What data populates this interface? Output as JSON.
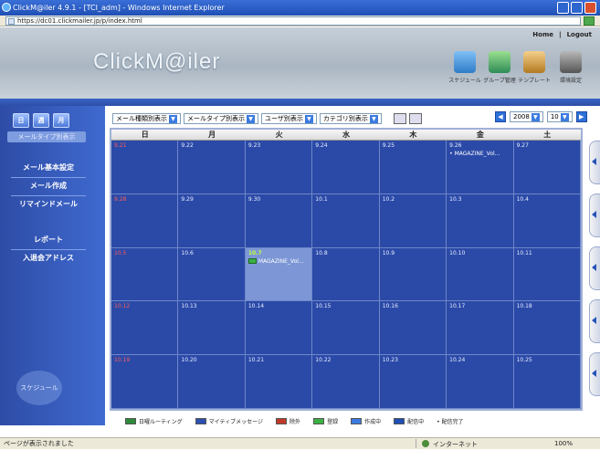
{
  "window": {
    "title": "ClickM@iler 4.9.1 - [TCI_adm] - Windows Internet Explorer"
  },
  "address": {
    "url": "https://dc01.clickmailer.jp/p/index.html"
  },
  "header": {
    "logo": "ClickM@iler",
    "links": {
      "home": "Home",
      "sep": "|",
      "logout": "Logout"
    },
    "icons": [
      {
        "label": "スケジュール",
        "icon": "schedule-icon",
        "color": "#3a8fd8"
      },
      {
        "label": "グループ管理",
        "icon": "group-icon",
        "color": "#2e8b57"
      },
      {
        "label": "テンプレート",
        "icon": "template-icon",
        "color": "#c58a2c"
      },
      {
        "label": "環境設定",
        "icon": "settings-icon",
        "color": "#555555"
      }
    ]
  },
  "sidebar": {
    "active_tab": "メールタイプ別表示",
    "items": [
      "メール基本設定",
      "メール作成",
      "リマインドメール",
      "レポート",
      "入退会アドレス"
    ],
    "schedule_label": "スケジュール"
  },
  "toolbar": {
    "filters": [
      "メール種類別表示",
      "メールタイプ別表示",
      "ユーザ別表示",
      "カテゴリ別表示"
    ],
    "year": "2008",
    "month": "10"
  },
  "calendar": {
    "weekdays": [
      "日",
      "月",
      "火",
      "水",
      "木",
      "金",
      "土"
    ],
    "weeks": [
      [
        {
          "d": "9.21"
        },
        {
          "d": "9.22"
        },
        {
          "d": "9.23"
        },
        {
          "d": "9.24"
        },
        {
          "d": "9.25"
        },
        {
          "d": "9.26",
          "event": "• MAGAZINE_Vol..."
        },
        {
          "d": "9.27"
        }
      ],
      [
        {
          "d": "9.28"
        },
        {
          "d": "9.29"
        },
        {
          "d": "9.30"
        },
        {
          "d": "10.1"
        },
        {
          "d": "10.2"
        },
        {
          "d": "10.3"
        },
        {
          "d": "10.4"
        }
      ],
      [
        {
          "d": "10.5"
        },
        {
          "d": "10.6"
        },
        {
          "d": "10.7",
          "today": true,
          "event": "MAGAZINE_Vol..."
        },
        {
          "d": "10.8"
        },
        {
          "d": "10.9"
        },
        {
          "d": "10.10"
        },
        {
          "d": "10.11"
        }
      ],
      [
        {
          "d": "10.12"
        },
        {
          "d": "10.13"
        },
        {
          "d": "10.14"
        },
        {
          "d": "10.15"
        },
        {
          "d": "10.16"
        },
        {
          "d": "10.17"
        },
        {
          "d": "10.18"
        }
      ],
      [
        {
          "d": "10.19"
        },
        {
          "d": "10.20"
        },
        {
          "d": "10.21"
        },
        {
          "d": "10.22"
        },
        {
          "d": "10.23"
        },
        {
          "d": "10.24"
        },
        {
          "d": "10.25"
        }
      ]
    ]
  },
  "legend": [
    {
      "label": "日曜ルーティング",
      "color": "#2d8a3a"
    },
    {
      "label": "マイティブメッセージ",
      "color": "#2c4fb0"
    },
    {
      "label": "除外",
      "color": "#c0392b"
    },
    {
      "label": "登録",
      "color": "#3cb043"
    },
    {
      "label": "作成中",
      "color": "#3b7be0"
    },
    {
      "label": "配信中",
      "color": "#1f4fb4"
    },
    {
      "label": "• 配信完了",
      "color": ""
    }
  ],
  "status": {
    "left": "ページが表示されました",
    "zone": "インターネット",
    "zoom": "100%"
  }
}
